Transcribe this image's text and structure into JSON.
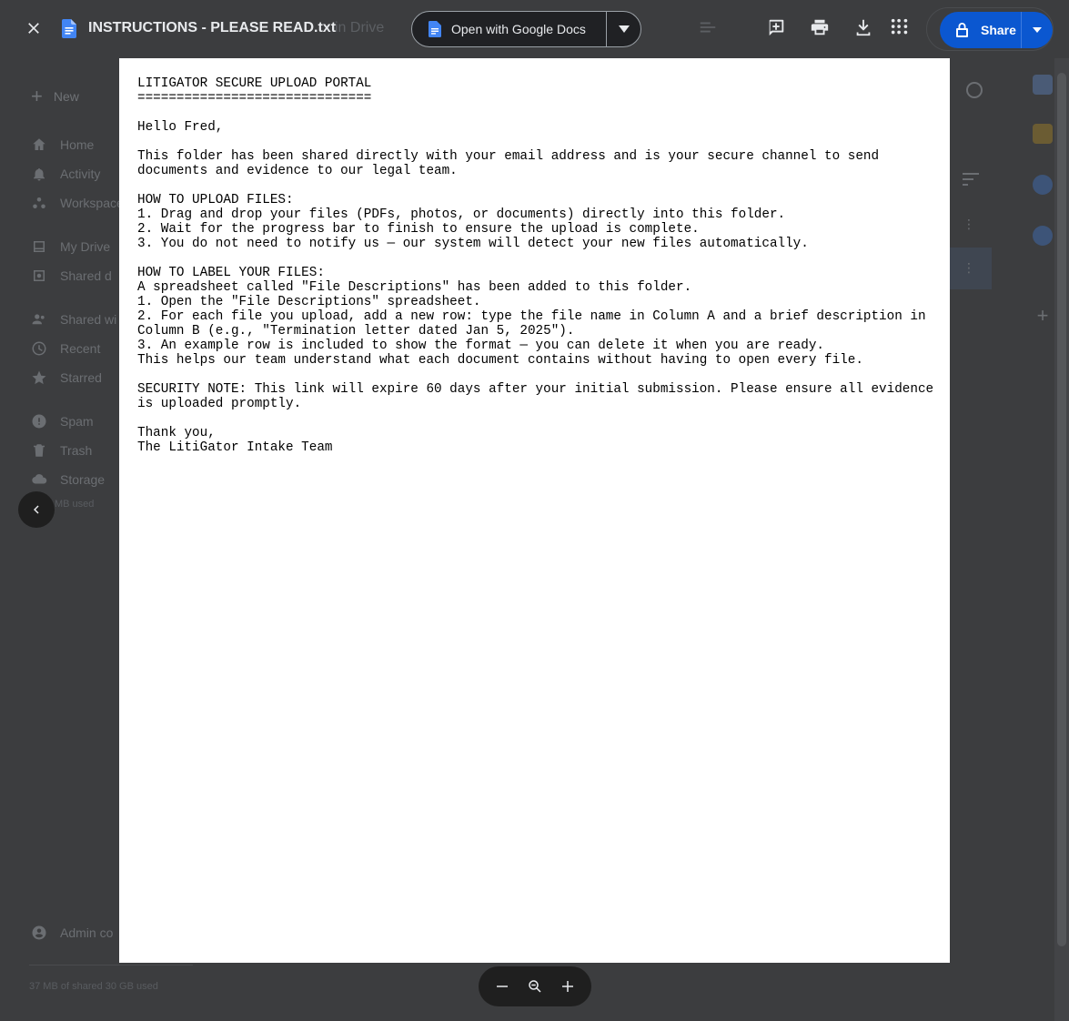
{
  "viewer": {
    "file_name": "INSTRUCTIONS - PLEASE READ.txt",
    "open_with_label": "Open with Google Docs",
    "share_label": "Share"
  },
  "background": {
    "title_fragment": "in Drive",
    "new_label": "New",
    "nav": [
      "Home",
      "Activity",
      "Workspace",
      "My Drive",
      "Shared d",
      "Shared wi",
      "Recent",
      "Starred",
      "Spam",
      "Trash",
      "Storage"
    ],
    "storage_used": "MB used",
    "admin_label": "Admin co",
    "shared_storage": "37 MB of shared 30 GB used"
  },
  "document": {
    "lines": [
      "LITIGATOR SECURE UPLOAD PORTAL",
      "==============================",
      "",
      "Hello Fred,",
      "",
      "This folder has been shared directly with your email address and is your secure channel to send",
      "documents and evidence to our legal team.",
      "",
      "HOW TO UPLOAD FILES:",
      "1. Drag and drop your files (PDFs, photos, or documents) directly into this folder.",
      "2. Wait for the progress bar to finish to ensure the upload is complete.",
      "3. You do not need to notify us — our system will detect your new files automatically.",
      "",
      "HOW TO LABEL YOUR FILES:",
      "A spreadsheet called \"File Descriptions\" has been added to this folder.",
      "1. Open the \"File Descriptions\" spreadsheet.",
      "2. For each file you upload, add a new row: type the file name in Column A and a brief description in",
      "Column B (e.g., \"Termination letter dated Jan 5, 2025\").",
      "3. An example row is included to show the format — you can delete it when you are ready.",
      "This helps our team understand what each document contains without having to open every file.",
      "",
      "SECURITY NOTE: This link will expire 60 days after your initial submission. Please ensure all evidence",
      "is uploaded promptly.",
      "",
      "Thank you,",
      "The LitiGator Intake Team"
    ]
  },
  "icons": {
    "close": "close-icon",
    "add_comment": "add-comment-icon",
    "print": "print-icon",
    "download": "download-icon",
    "more": "more-vert-icon",
    "lock": "lock-icon",
    "zoom_out": "minus-icon",
    "zoom_reset": "magnifier-icon",
    "zoom_in": "plus-icon"
  },
  "colors": {
    "share_blue": "#0b57d0",
    "docs_blue": "#4285f4",
    "overlay": "#3c3d3f"
  }
}
